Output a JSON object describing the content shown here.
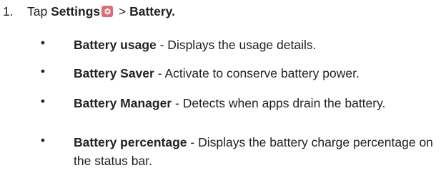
{
  "step": {
    "number": "1.",
    "prefix": "Tap ",
    "settings_label": "Settings",
    "separator": " > ",
    "battery_label": "Battery.",
    "settings_icon": "gear-icon",
    "settings_icon_color": "#e06c73"
  },
  "items": [
    {
      "bullet": "•",
      "title": "Battery usage",
      "description": " - Displays the usage details."
    },
    {
      "bullet": "•",
      "title": "Battery Saver",
      "description": " - Activate to conserve battery power."
    },
    {
      "bullet": "•",
      "title": "Battery Manager",
      "description": " - Detects when apps drain the battery."
    },
    {
      "bullet": "•",
      "title": "Battery percentage",
      "description": " - Displays the battery charge percentage on the status bar."
    }
  ]
}
